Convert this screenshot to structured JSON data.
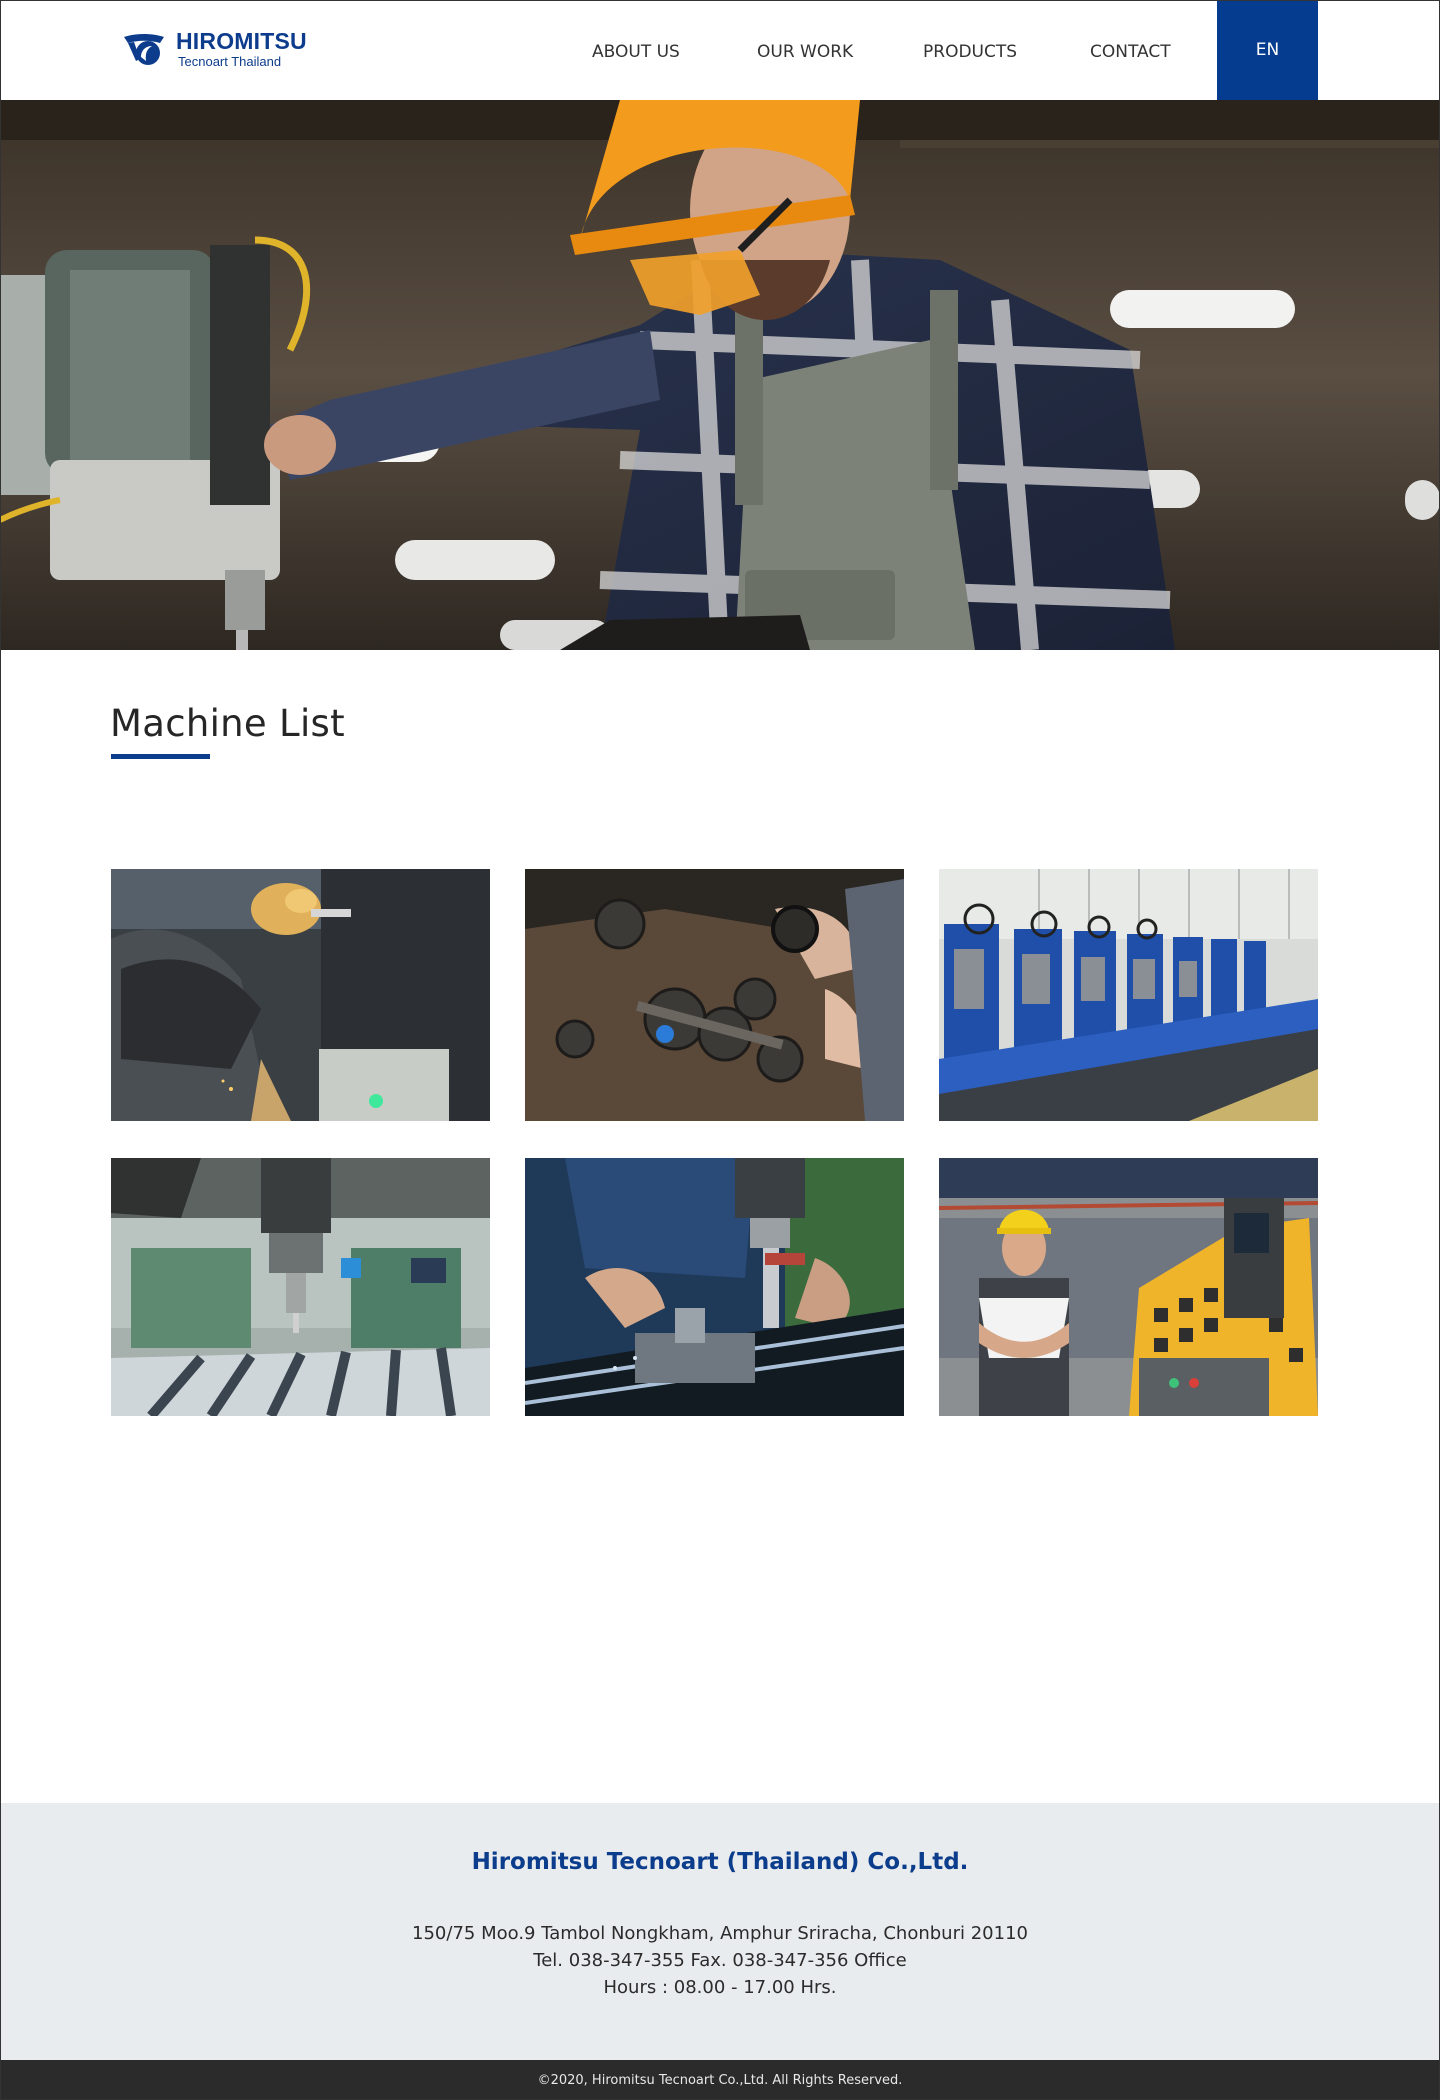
{
  "header": {
    "logo": {
      "name": "HIROMITSU",
      "subtitle": "Tecnoart Thailand"
    },
    "nav": [
      {
        "label": "ABOUT US"
      },
      {
        "label": "OUR WORK"
      },
      {
        "label": "PRODUCTS"
      },
      {
        "label": "CONTACT"
      }
    ],
    "language": "EN"
  },
  "hero": {
    "image": "factory-worker-at-drill-press"
  },
  "main": {
    "title": "Machine List",
    "gallery": [
      {
        "image": "worker-gloved-hands-welding-machine"
      },
      {
        "image": "hands-assembling-gears-on-table"
      },
      {
        "image": "row-of-blue-industrial-machines"
      },
      {
        "image": "drill-press-spindle-in-workshop"
      },
      {
        "image": "hands-operating-milling-machine"
      },
      {
        "image": "smiling-worker-yellow-hardhat-by-machine"
      }
    ]
  },
  "footer": {
    "company": "Hiromitsu Tecnoart (Thailand) Co.,Ltd.",
    "address": "150/75 Moo.9 Tambol Nongkham, Amphur Sriracha, Chonburi 20110",
    "phone": "Tel. 038-347-355  Fax. 038-347-356 Office",
    "hours": "Hours : 08.00 - 17.00 Hrs.",
    "copyright": "©2020, Hiromitsu Tecnoart Co.,Ltd. All Rights Reserved."
  },
  "colors": {
    "brand": "#0b3d8c",
    "footer_bg": "#e9ecee",
    "copyright_bg": "#2b2b2b"
  }
}
